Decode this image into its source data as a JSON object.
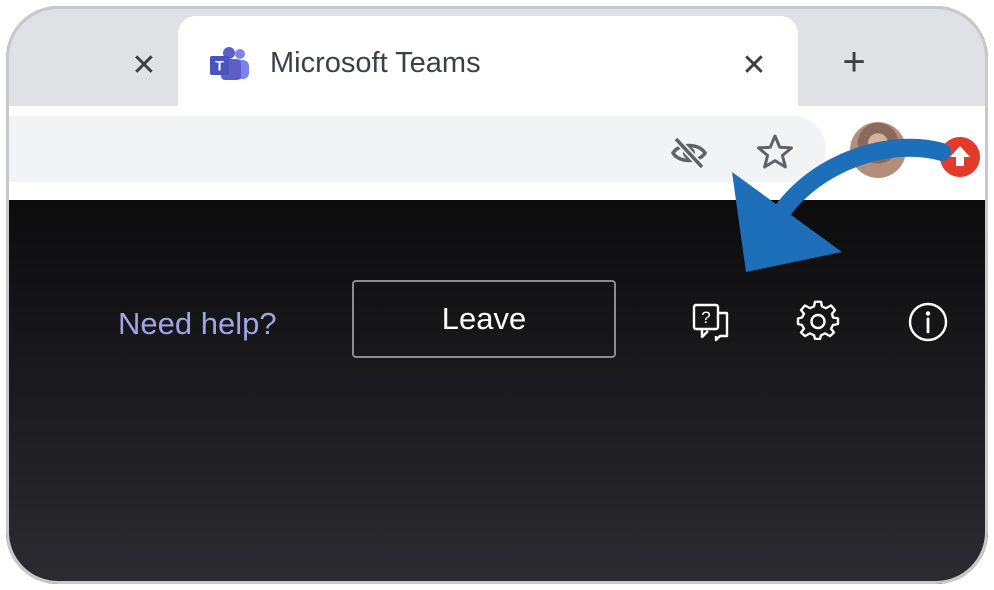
{
  "browser": {
    "active_tab": {
      "title": "Microsoft Teams",
      "close_glyph": "✕",
      "icon": "teams-icon"
    },
    "previous_tab": {
      "close_glyph": "✕"
    },
    "new_tab_glyph": "+",
    "toolbar": {
      "icons": [
        "eye-off-icon",
        "star-icon",
        "avatar",
        "update-badge-icon"
      ]
    }
  },
  "teams": {
    "need_help_label": "Need help?",
    "leave_label": "Leave",
    "icons": [
      "help-icon",
      "settings-icon",
      "info-icon"
    ]
  },
  "annotation": {
    "type": "arrow",
    "color": "#1c6fb8"
  },
  "colors": {
    "help_text": "#a2a3e6",
    "update_badge": "#e33a2b",
    "teams_brand": "#5b5fc7"
  }
}
